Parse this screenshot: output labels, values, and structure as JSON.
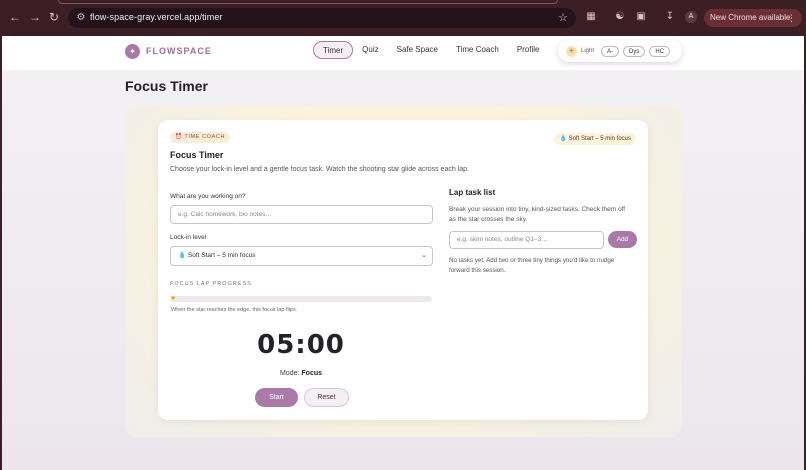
{
  "browser": {
    "url": "flow-space-gray.vercel.app/timer",
    "update_label": "New Chrome available",
    "profile_initial": "A"
  },
  "header": {
    "brand_name": "FLOWSPACE",
    "nav": [
      {
        "label": "Timer",
        "active": true
      },
      {
        "label": "Quiz"
      },
      {
        "label": "Safe Space"
      },
      {
        "label": "Time Coach"
      },
      {
        "label": "Profile"
      }
    ],
    "theme_label": "Light",
    "font_toggle": "A-",
    "dys_toggle": "Dys",
    "hc_toggle": "HC"
  },
  "page_title": "Focus Timer",
  "card": {
    "badge_coach": "TIME COACH",
    "badge_level": "Soft Start – 5 min focus",
    "title": "Focus Timer",
    "description": "Choose your lock-in level and a gentle focus task. Watch the shooting star glide across each lap.",
    "task_label": "What are you working on?",
    "task_placeholder": "e.g. Calc homework, bio notes…",
    "level_label": "Lock-in level",
    "level_value": "Soft Start – 5 min focus",
    "progress_label": "FOCUS LAP PROGRESS",
    "progress_value": 0,
    "progress_note": "When the star reaches the edge, this focus lap flips.",
    "timer": "05:00",
    "mode_label": "Mode:",
    "mode_value": "Focus",
    "start_label": "Start",
    "reset_label": "Reset"
  },
  "lap": {
    "title": "Lap task list",
    "description": "Break your session into tiny, kind-sized tasks. Check them off as the star crosses the sky.",
    "input_placeholder": "e.g. skim notes, outline Q1–3…",
    "add_label": "Add",
    "empty_text": "No tasks yet. Add two or three tiny things you'd like to nudge forward this session."
  },
  "colors": {
    "accent": "#a97aa6",
    "chrome_bg": "#3b1f24"
  }
}
